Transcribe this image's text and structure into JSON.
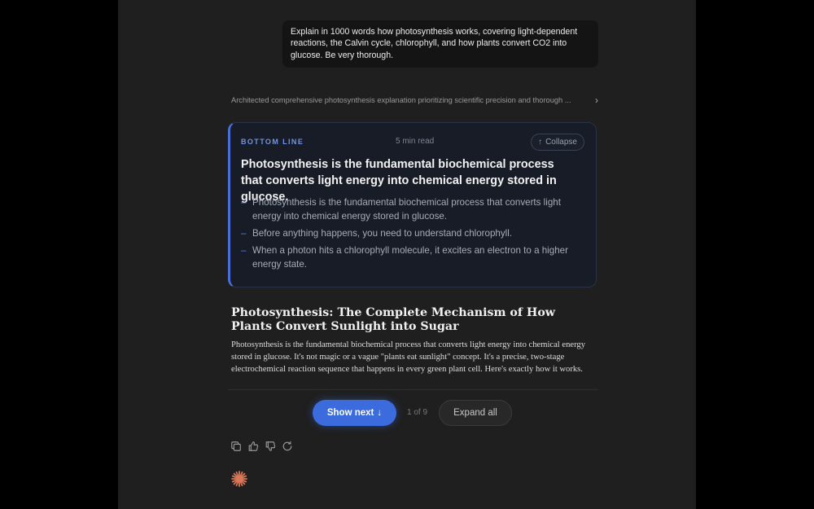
{
  "user_message": {
    "text": "Explain in 1000 words how photosynthesis works, covering light-dependent reactions, the Calvin cycle, chlorophyll, and how plants convert CO2 into glucose. Be very thorough."
  },
  "thinking": {
    "summary": "Architected comprehensive photosynthesis explanation prioritizing scientific precision and thorough ..."
  },
  "bottom_line": {
    "label": "BOTTOM LINE",
    "read_time": "5 min read",
    "collapse_label": "Collapse",
    "title": "Photosynthesis is the fundamental biochemical process that converts light energy into chemical energy stored in glucose.",
    "points": [
      "Photosynthesis is the fundamental biochemical process that converts light energy into chemical energy stored in glucose.",
      "Before anything happens, you need to understand chlorophyll.",
      "When a photon hits a chlorophyll molecule, it excites an electron to a higher energy state."
    ]
  },
  "article": {
    "title": "Photosynthesis: The Complete Mechanism of How Plants Convert Sunlight into Sugar",
    "body": "Photosynthesis is the fundamental biochemical process that converts light energy into chemical energy stored in glucose. It's not magic or a vague \"plants eat sunlight\" concept. It's a precise, two-stage electrochemical reaction sequence that happens in every green plant cell. Here's exactly how it works."
  },
  "controls": {
    "show_next_label": "Show next",
    "pager": "1 of 9",
    "expand_all_label": "Expand all"
  },
  "colors": {
    "accent": "#3b6bdc",
    "label_blue": "#6f94ec",
    "logo": "#d97757"
  }
}
